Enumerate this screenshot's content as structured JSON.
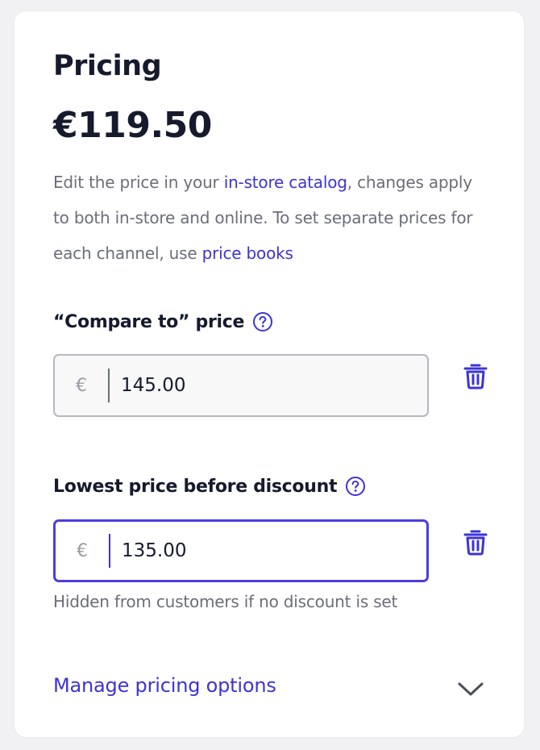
{
  "pricing": {
    "title": "Pricing",
    "price": "€119.50",
    "description": {
      "part1": "Edit the price in your ",
      "link1": "in-store catalog",
      "part2": ", changes apply to both in-store and online. To set separate prices for each channel, use ",
      "link2": "price books"
    },
    "compare_to": {
      "label": "“Compare to” price",
      "currency": "€",
      "value": "145.00"
    },
    "lowest_price": {
      "label": "Lowest price before discount",
      "currency": "€",
      "value": "135.00",
      "hint": "Hidden from customers if no discount is set"
    },
    "manage_link": "Manage pricing options"
  },
  "icons": {
    "help": "question-circle-icon",
    "delete": "trash-icon",
    "expand": "chevron-down-icon"
  },
  "colors": {
    "accent": "#3d33d6",
    "focus_border": "#4a3ee0",
    "text_primary": "#151a2d",
    "text_secondary": "#6b6e78"
  }
}
